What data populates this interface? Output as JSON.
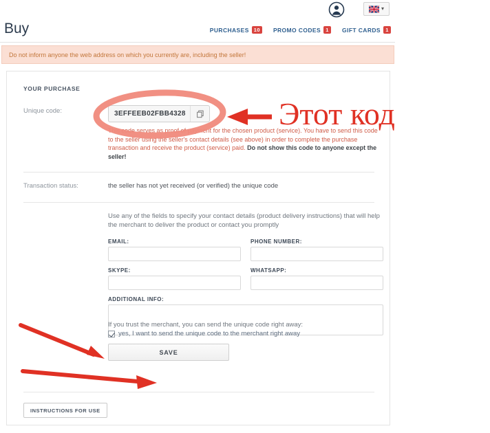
{
  "topbar": {
    "avatar_icon": "user-avatar-icon",
    "language": {
      "flag_icon": "uk-flag-icon",
      "chevron_icon": "chevron-down-icon",
      "caret": "▾"
    }
  },
  "header": {
    "brand": "Buy",
    "nav": [
      {
        "label": "PURCHASES",
        "badge": "10"
      },
      {
        "label": "PROMO CODES",
        "badge": "1"
      },
      {
        "label": "GIFT CARDS",
        "badge": "1"
      }
    ]
  },
  "warning": {
    "text": "Do not inform anyone the web address on which you currently are, including the seller!"
  },
  "purchase": {
    "section_title": "YOUR PURCHASE",
    "unique_code_label": "Unique code:",
    "unique_code_value": "3EFFEEB02FBB4328",
    "copy_icon": "copy-icon",
    "code_note_part1": "This code serves as proof of payment for the chosen product (service). You have to send this code to the seller using the seller's contact details (see above) in order to complete the purchase transaction and receive the product (service) paid. ",
    "code_note_bold": "Do not show this code to anyone except the seller!",
    "status_label": "Transaction status:",
    "status_value": "the seller has not yet received (or verified) the unique code"
  },
  "contact": {
    "note": "Use any of the fields to specify your contact details (product delivery instructions) that will help the merchant to deliver the product or contact you promptly",
    "fields": [
      {
        "label": "EMAIL:",
        "value": "",
        "placeholder": ""
      },
      {
        "label": "PHONE NUMBER:",
        "value": "",
        "placeholder": ""
      },
      {
        "label": "SKYPE:",
        "value": "",
        "placeholder": ""
      },
      {
        "label": "WHATSAPP:",
        "value": "",
        "placeholder": ""
      }
    ],
    "additional_label": "ADDITIONAL INFO:",
    "additional_value": "",
    "additional_placeholder": ""
  },
  "trust": {
    "note": "If you trust the merchant, you can send the unique code right away:",
    "checkbox_label": "yes, I want to send the unique code to the merchant right away",
    "checkbox_checked": true
  },
  "actions": {
    "save_label": "SAVE",
    "instructions_label": "INSTRUCTIONS FOR USE"
  },
  "annotation": {
    "text": "Этот код",
    "color": "#e03124",
    "marks": [
      "oval-around-unique-code",
      "arrow-to-unique-code",
      "arrow-to-checkbox",
      "arrow-to-save-button"
    ]
  },
  "colors": {
    "brand_text": "#2d3c4e",
    "nav_link": "#2f5f8f",
    "badge_bg": "#d9443f",
    "warning_bg": "#fbdfd4",
    "warning_text": "#c2763a",
    "note_red": "#cf5b47",
    "annotation_red": "#e03124"
  }
}
